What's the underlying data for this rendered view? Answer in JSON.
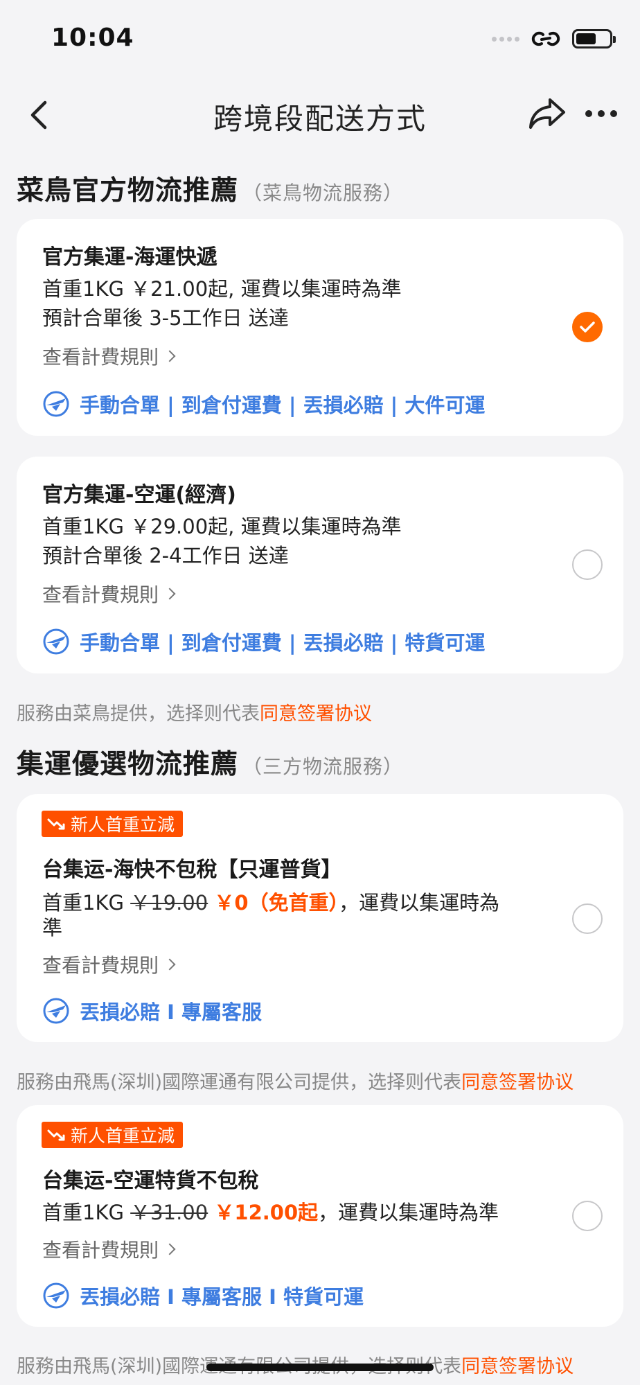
{
  "status": {
    "time": "10:04"
  },
  "nav": {
    "title": "跨境段配送方式"
  },
  "section1": {
    "title": "菜鳥官方物流推薦",
    "subtitle": "（菜鳥物流服務）"
  },
  "section2": {
    "title": "集運優選物流推薦",
    "subtitle": "（三方物流服務）"
  },
  "cards": [
    {
      "name": "官方集運-海運快遞",
      "line1": "首重1KG ￥21.00起, 運費以集運時為準",
      "line2": "預計合單後 3-5工作日 送達",
      "rule": "查看計費規則",
      "features": "手動合單 | 到倉付運費 | 丟損必賠 | 大件可運",
      "selected": true
    },
    {
      "name": "官方集運-空運(經濟)",
      "line1": "首重1KG ￥29.00起, 運費以集運時為準",
      "line2": "預計合單後 2-4工作日 送達",
      "rule": "查看計費規則",
      "features": "手動合單 | 到倉付運費 | 丟損必賠 | 特貨可運",
      "selected": false
    },
    {
      "badge": "新人首重立減",
      "name": "台集运-海快不包稅【只運普貨】",
      "prefix": "首重1KG",
      "old_price": "￥19.00",
      "new_price": "￥0（免首重）",
      "suffix": "，運費以集運時為",
      "suffix2": "準",
      "rule": "查看計費規則",
      "features": "丟損必賠 I 專屬客服",
      "selected": false
    },
    {
      "badge": "新人首重立減",
      "name": "台集运-空運特貨不包稅",
      "prefix": "首重1KG",
      "old_price": "￥31.00",
      "new_price": "￥12.00起",
      "suffix": "，運費以集運時為準",
      "rule": "查看計費規則",
      "features": "丟損必賠 I 專屬客服 I 特貨可運",
      "selected": false
    }
  ],
  "notices": [
    {
      "text": "服務由菜鳥提供，选择则代表",
      "link": "同意签署协议"
    },
    {
      "text": "服務由飛馬(深圳)國際運通有限公司提供，选择则代表",
      "link": "同意签署协议"
    },
    {
      "text": "服務由飛馬(深圳)國際運通有限公司提供，选择则代表",
      "link": "同意签署协议"
    }
  ],
  "colors": {
    "accent": "#ff5000",
    "feature_blue": "#3e7de0",
    "check_orange": "#ff6a00"
  }
}
